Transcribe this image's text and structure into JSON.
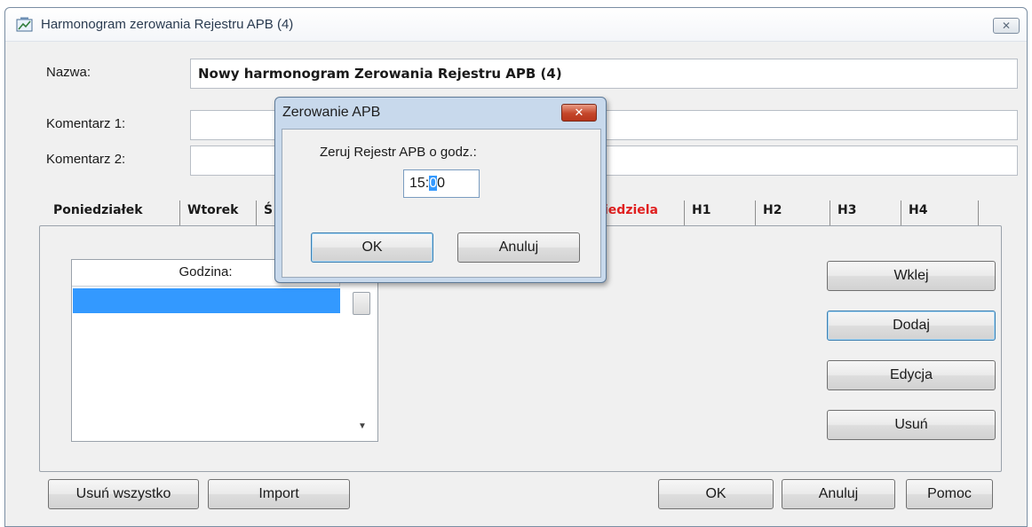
{
  "window": {
    "title": "Harmonogram zerowania Rejestru APB (4)",
    "close_glyph": "✕"
  },
  "form": {
    "name_label": "Nazwa:",
    "name_value": "Nowy harmonogram Zerowania Rejestru APB (4)",
    "comment1_label": "Komentarz 1:",
    "comment1_value": "",
    "comment2_label": "Komentarz 2:",
    "comment2_value": ""
  },
  "tabs": [
    {
      "label": "Poniedziałek"
    },
    {
      "label": "Wtorek"
    },
    {
      "label": "Ś"
    },
    {
      "label": "iedziela"
    },
    {
      "label": "H1"
    },
    {
      "label": "H2"
    },
    {
      "label": "H3"
    },
    {
      "label": "H4"
    }
  ],
  "list": {
    "header": "Godzina:"
  },
  "side_buttons": {
    "paste": "Wklej",
    "add": "Dodaj",
    "edit": "Edycja",
    "delete": "Usuń"
  },
  "footer": {
    "delete_all": "Usuń wszystko",
    "import": "Import",
    "ok": "OK",
    "cancel": "Anuluj",
    "help": "Pomoc"
  },
  "popup": {
    "title": "Zerowanie APB",
    "close_glyph": "✕",
    "prompt": "Zeruj Rejestr APB o godz.:",
    "time_hours": "15:",
    "time_selected": "0",
    "time_rest": "0",
    "ok": "OK",
    "cancel": "Anuluj"
  }
}
